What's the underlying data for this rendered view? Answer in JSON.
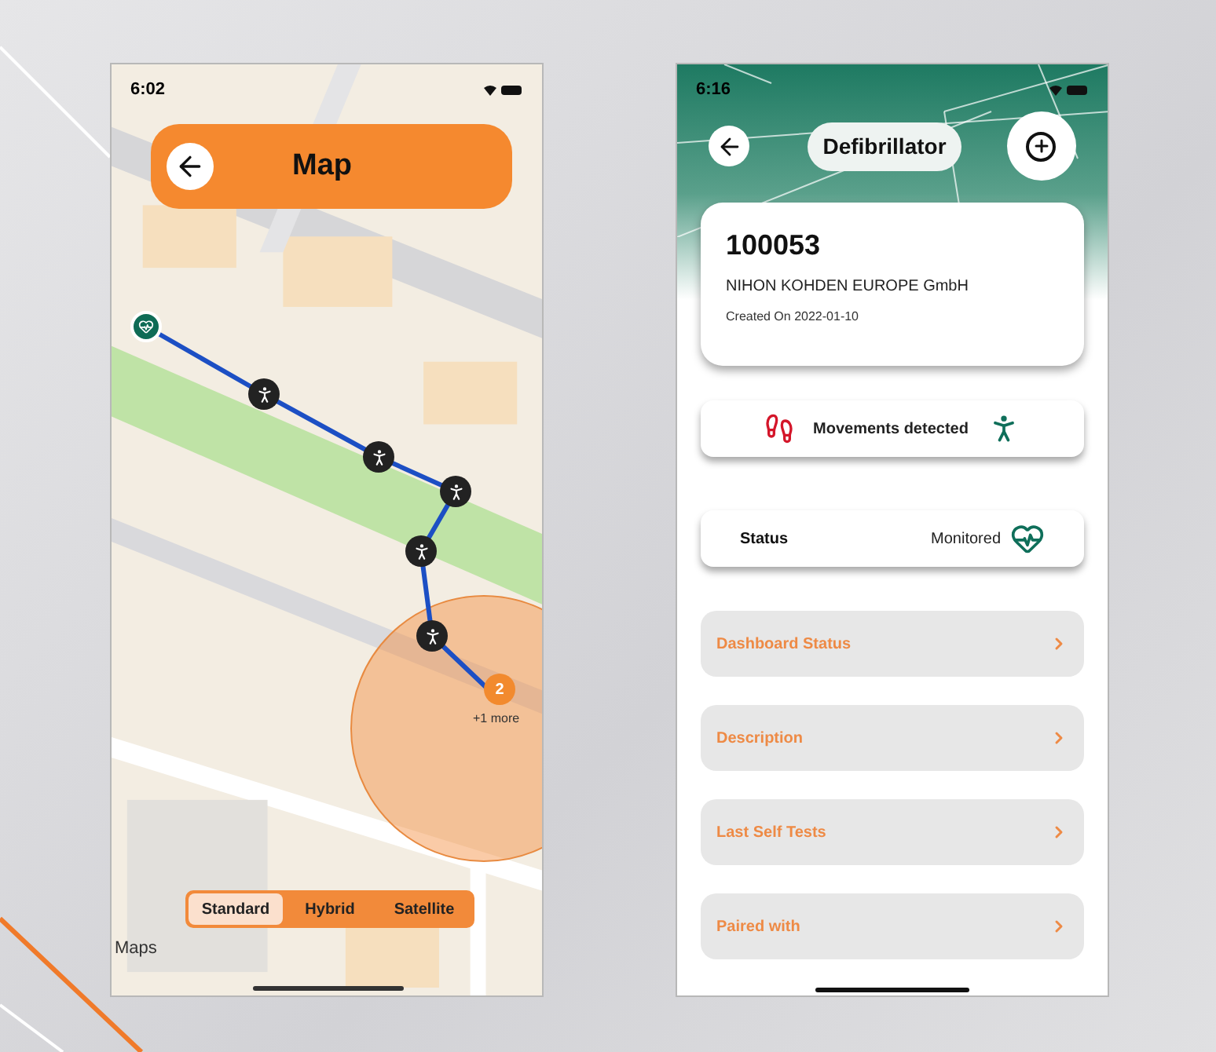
{
  "map_screen": {
    "status_time": "6:02",
    "title": "Map",
    "cluster": {
      "count": "2",
      "caption": "+1 more"
    },
    "map_types": [
      {
        "label": "Standard",
        "selected": true
      },
      {
        "label": "Hybrid",
        "selected": false
      },
      {
        "label": "Satellite",
        "selected": false
      }
    ],
    "attribution": "Maps"
  },
  "detail_screen": {
    "status_time": "6:16",
    "title": "Defibrillator",
    "device": {
      "id": "100053",
      "manufacturer": "NIHON KOHDEN EUROPE GmbH",
      "created": "Created On 2022-01-10"
    },
    "movement": "Movements detected",
    "status": {
      "label": "Status",
      "value": "Monitored"
    },
    "menu": [
      {
        "label": "Dashboard Status"
      },
      {
        "label": "Description"
      },
      {
        "label": "Last Self Tests"
      },
      {
        "label": "Paired with"
      }
    ]
  }
}
